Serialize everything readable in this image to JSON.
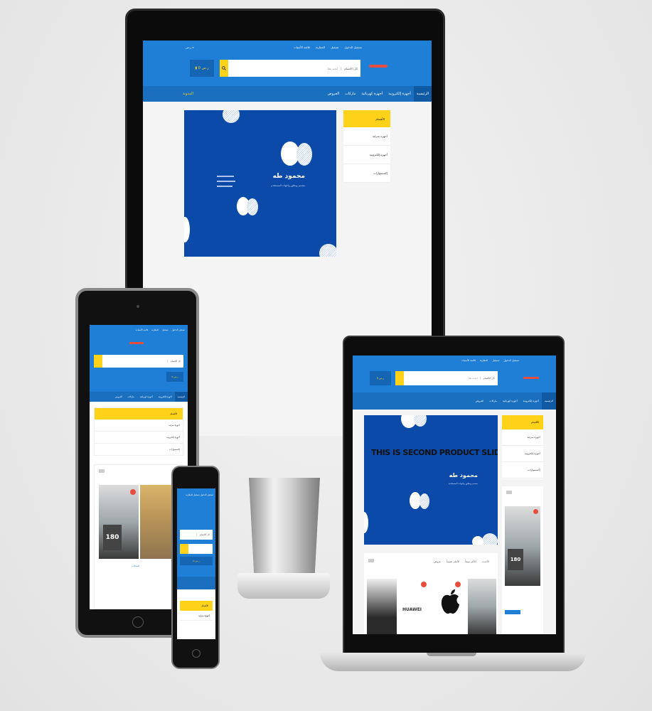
{
  "theme": {
    "primary": "#1f7fd6",
    "nav": "#1a6fbf",
    "accent": "#ffd21a",
    "slide": "#0b4aa8"
  },
  "site": {
    "top_links": [
      "تسجيل الدخول",
      "تسجيل",
      "المقارنة",
      "قائمة الأمنيات"
    ],
    "search_placeholder": "ابحث هنا",
    "category_select": "كل الأقسام",
    "cart_label": "0 ر.س",
    "nav_items": [
      "الرئيسية",
      "أجهزة إلكترونية",
      "أجهزة كهربائية",
      "ماركات",
      "العروض"
    ],
    "nav_side": "المدونة",
    "category_panel_title": "الأقسام",
    "category_rows": [
      "أجهزة منزلية",
      "أجهزة إلكترونية",
      "إكسسوارات"
    ],
    "slider_name": "محمود طه",
    "slider_sub": "مصمم ومطور واجهات المستخدم",
    "slider_title_2": "THIS IS SECOND PRODUCT SLIDER",
    "product_tabs": [
      "الأحدث",
      "الأكثر مبيعاً",
      "الأعلى تقييماً",
      "عروض"
    ],
    "product_price": "180",
    "brand_name": "HUAWEI",
    "section_title": "المنتجات"
  },
  "icons": [
    "search-icon",
    "cart-icon",
    "apple-logo-icon",
    "huawei-logo-icon",
    "home-button-icon",
    "camera-icon"
  ]
}
